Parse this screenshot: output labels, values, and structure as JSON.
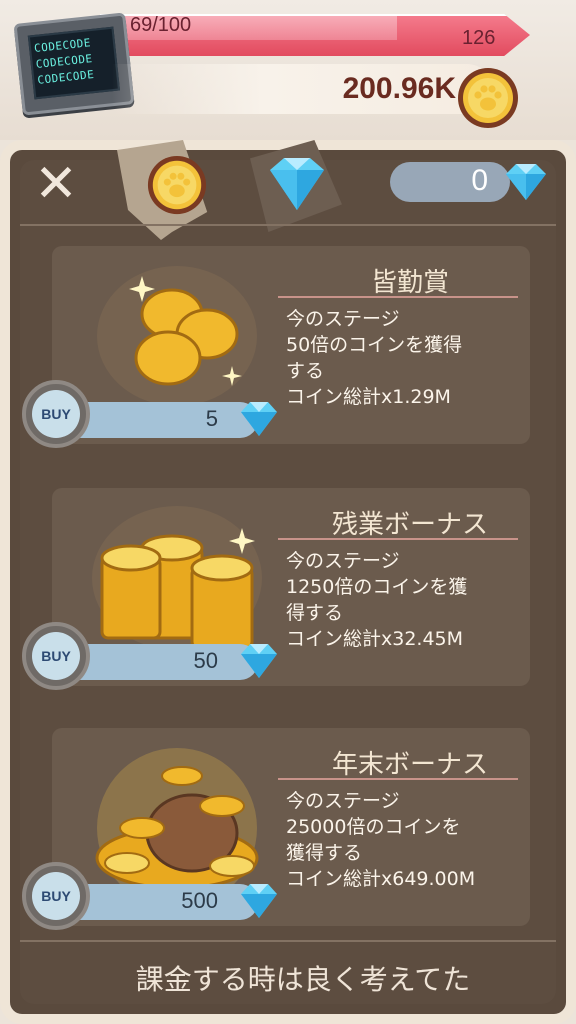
{
  "hud": {
    "chip_lines": [
      "CODECODE",
      "CODECODE",
      "CODECODE"
    ],
    "progress_text": "69/100",
    "progress_fraction": 0.69,
    "level": "126",
    "coin_total": "200.96K"
  },
  "panel": {
    "close_symbol": "✕",
    "gem_count": "0"
  },
  "items": [
    {
      "title": "皆勤賞",
      "desc": [
        "今のステージ",
        "50倍のコインを獲得",
        "する",
        "コイン総計x1.29M"
      ],
      "buy_label": "BUY",
      "price": "5"
    },
    {
      "title": "残業ボーナス",
      "desc": [
        "今のステージ",
        "1250倍のコインを獲",
        "得する",
        "コイン総計x32.45M"
      ],
      "buy_label": "BUY",
      "price": "50"
    },
    {
      "title": "年末ボーナス",
      "desc": [
        "今のステージ",
        "25000倍のコインを",
        "獲得する",
        "コイン総計x649.00M"
      ],
      "buy_label": "BUY",
      "price": "500"
    }
  ],
  "footer": {
    "message": "課金する時は良く考えてた"
  },
  "colors": {
    "gem": "#5fd0f5",
    "coin": "#f1b92d",
    "panel": "#5d4d40"
  },
  "icons": {
    "coin": "paw-coin-icon",
    "gem": "diamond-icon",
    "close": "close-icon"
  }
}
